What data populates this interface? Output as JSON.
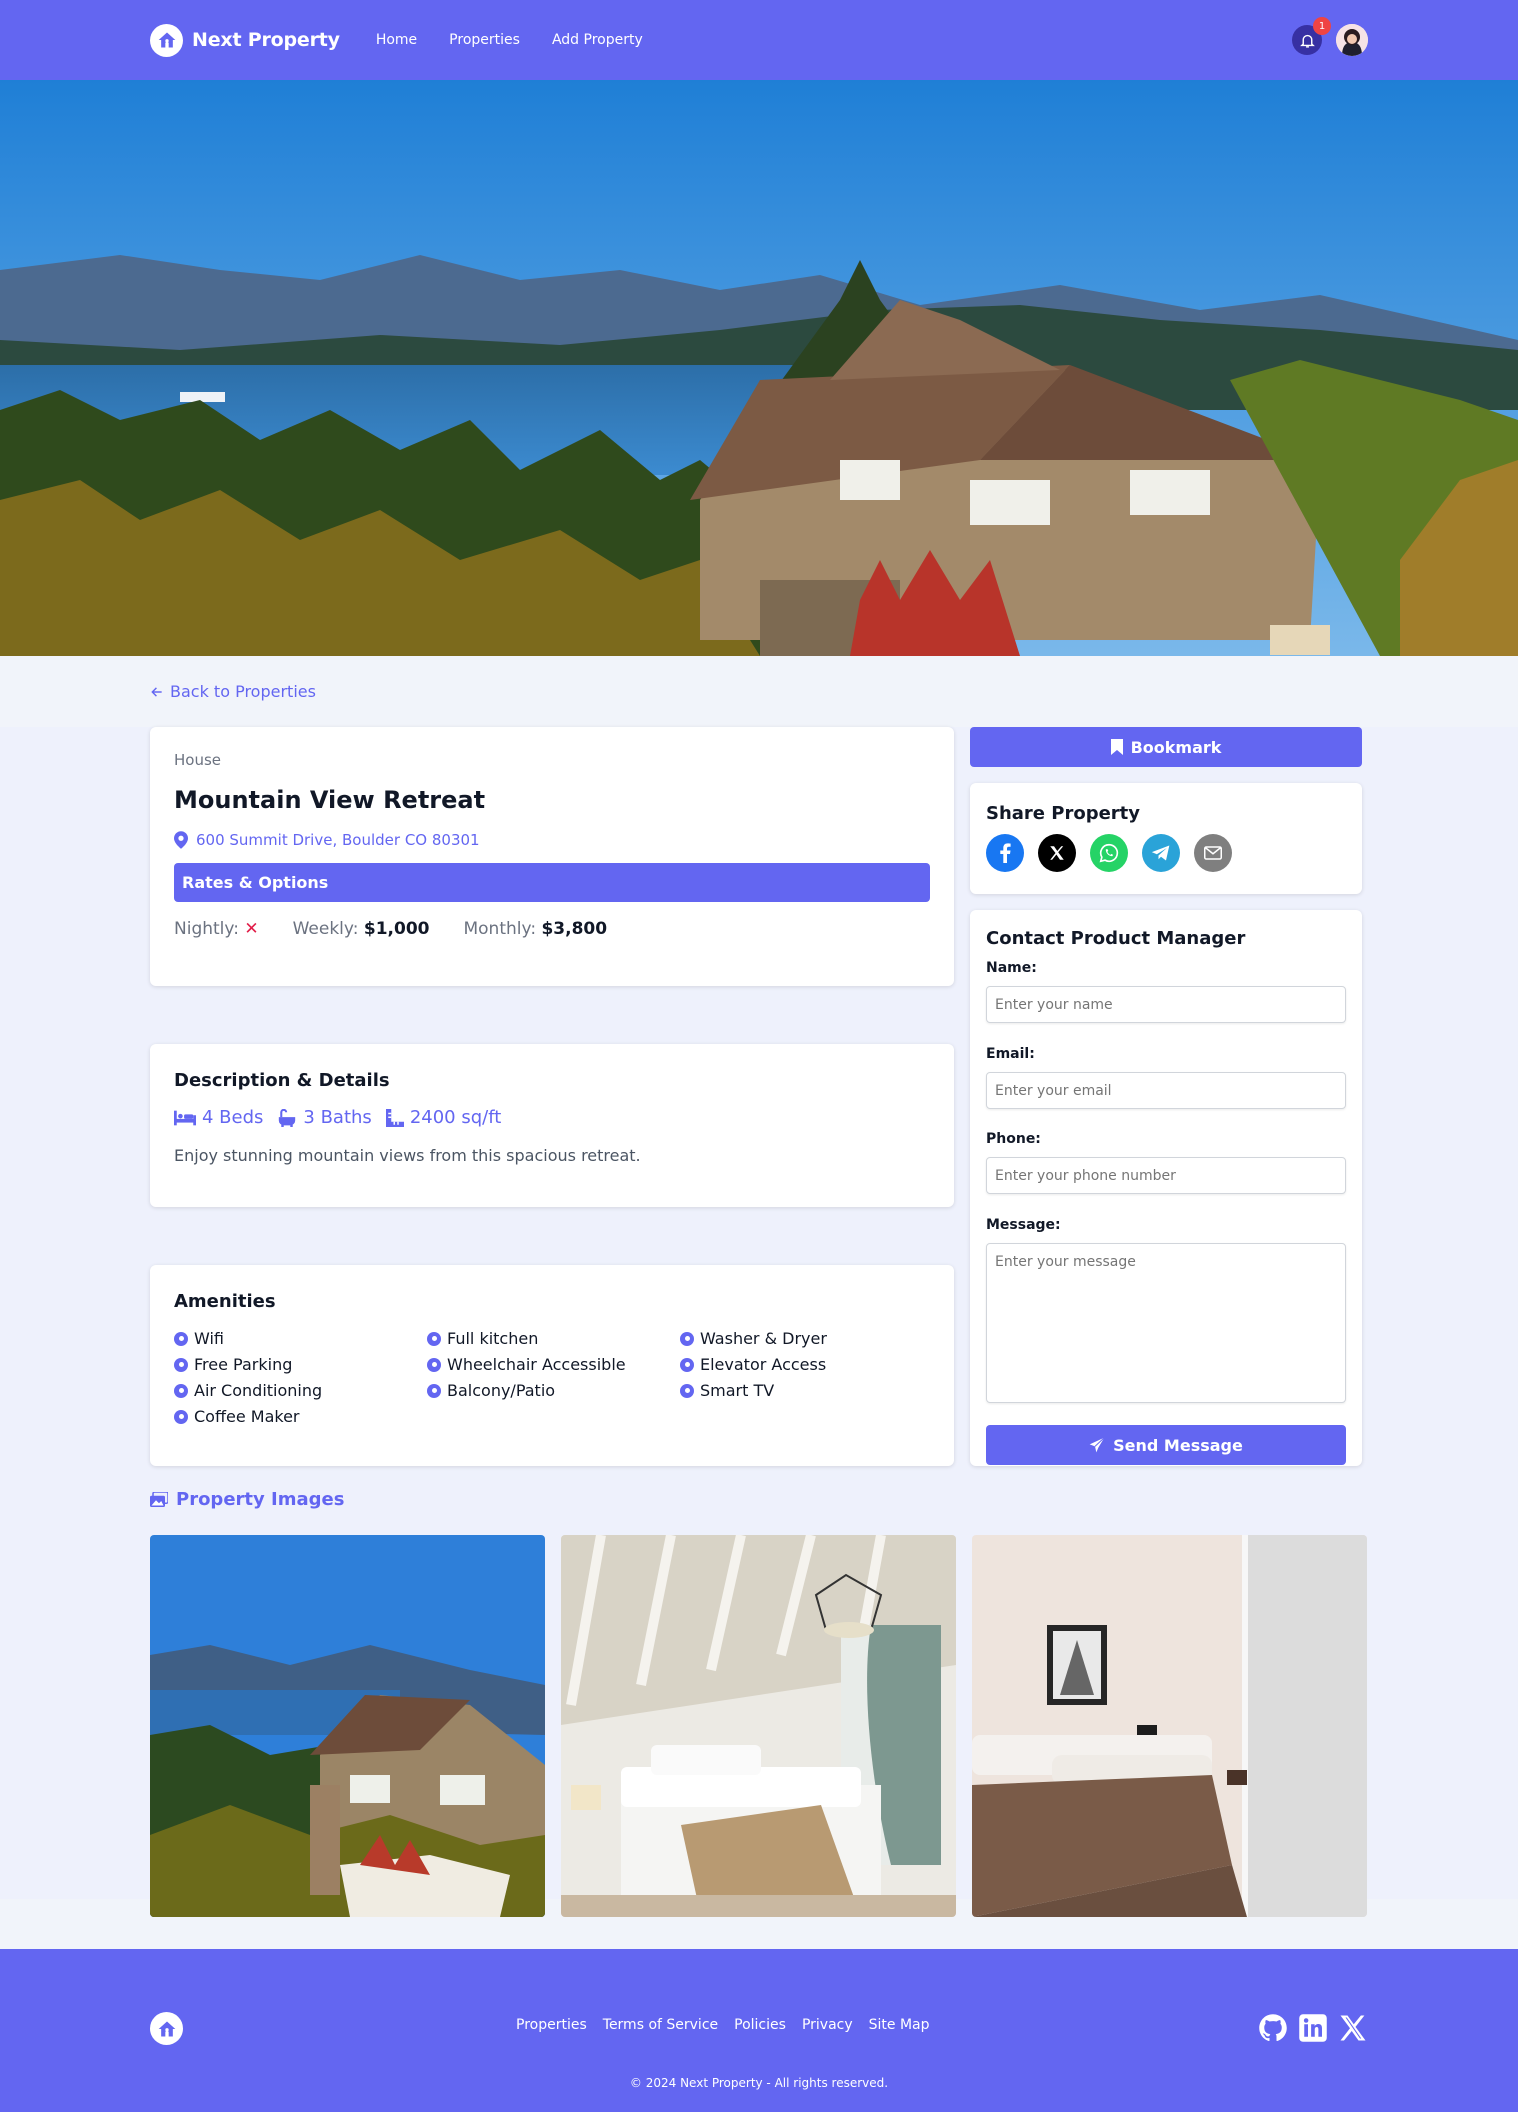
{
  "nav": {
    "brand": "Next Property",
    "links": [
      "Home",
      "Properties",
      "Add Property"
    ],
    "notification_count": "1"
  },
  "back_link": "Back to Properties",
  "property": {
    "type": "House",
    "name": "Mountain View Retreat",
    "address": "600 Summit Drive, Boulder CO 80301",
    "rates_title": "Rates & Options",
    "rates": {
      "nightly_label": "Nightly:",
      "nightly_value": "✕",
      "weekly_label": "Weekly:",
      "weekly_value": "$1,000",
      "monthly_label": "Monthly:",
      "monthly_value": "$3,800"
    }
  },
  "details": {
    "title": "Description & Details",
    "beds": "4 Beds",
    "baths": "3 Baths",
    "area": "2400 sq/ft",
    "description": "Enjoy stunning mountain views from this spacious retreat."
  },
  "amenities": {
    "title": "Amenities",
    "items": [
      "Wifi",
      "Full kitchen",
      "Washer & Dryer",
      "Free Parking",
      "Wheelchair Accessible",
      "Elevator Access",
      "Air Conditioning",
      "Balcony/Patio",
      "Smart TV",
      "Coffee Maker"
    ]
  },
  "sidebar": {
    "bookmark": "Bookmark",
    "share_title": "Share Property",
    "contact_title": "Contact Product Manager",
    "name_label": "Name:",
    "name_placeholder": "Enter your name",
    "email_label": "Email:",
    "email_placeholder": "Enter your email",
    "phone_label": "Phone:",
    "phone_placeholder": "Enter your phone number",
    "message_label": "Message:",
    "message_placeholder": "Enter your message",
    "send": "Send Message"
  },
  "images_title": "Property Images",
  "footer": {
    "links": [
      "Properties",
      "Terms of Service",
      "Policies",
      "Privacy",
      "Site Map"
    ],
    "copyright": "© 2024 Next Property - All rights reserved."
  },
  "colors": {
    "primary": "#6366f1",
    "background": "#f1f4fa",
    "danger": "#e11d48"
  }
}
